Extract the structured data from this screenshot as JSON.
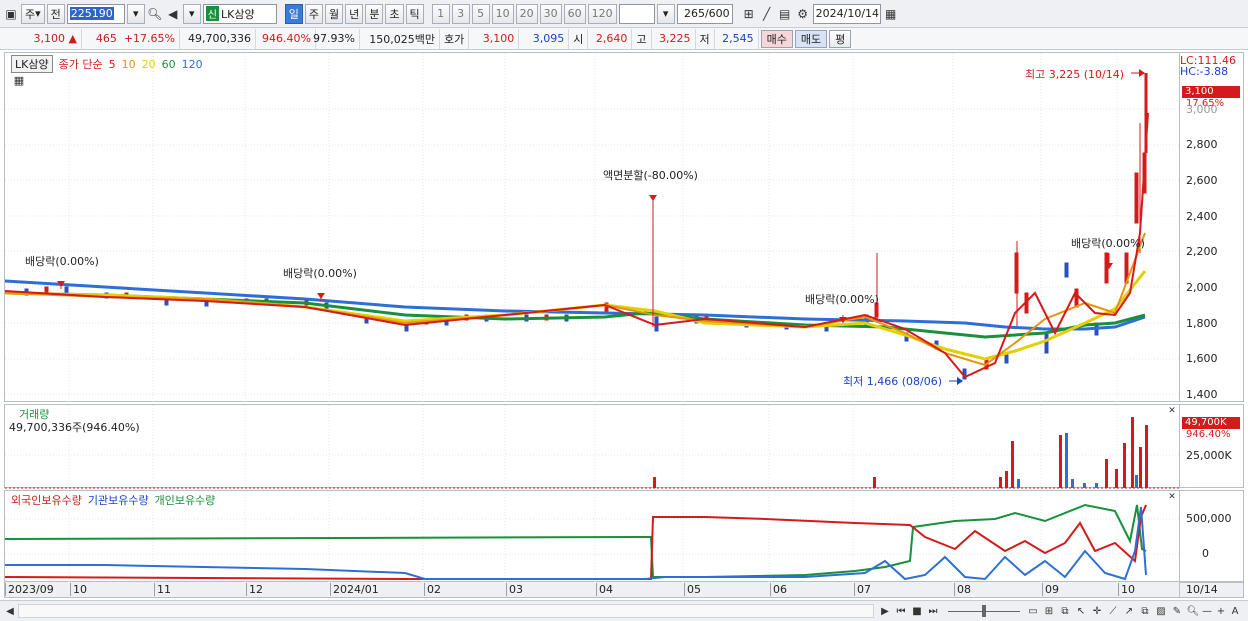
{
  "toolbar": {
    "mode_label": "주",
    "prev_label": "전",
    "code": "225190",
    "new_badge": "신",
    "stock_name": "LK삼양",
    "periods": [
      "일",
      "주",
      "월",
      "년",
      "분",
      "초",
      "틱"
    ],
    "active_period": "일",
    "intervals": [
      "1",
      "3",
      "5",
      "10",
      "20",
      "30",
      "60",
      "120"
    ],
    "count_value": "265",
    "count_total": "/600",
    "date": "2024/10/14"
  },
  "quote": {
    "price": "3,100",
    "arrow": "▲",
    "change": "465",
    "change_pct": "+17.65%",
    "volume": "49,700,336",
    "volume_ratio": "946.40%",
    "turnover": "97.93%",
    "amount": "150,025백만",
    "bid_label": "호가",
    "ask_price": "3,100",
    "bid_price": "3,095",
    "open_label": "시",
    "open": "2,640",
    "high_label": "고",
    "high": "3,225",
    "low_label": "저",
    "low": "2,545",
    "buy_label": "매수",
    "sell_label": "매도",
    "eval_label": "평"
  },
  "price_panel": {
    "legend_name": "LK삼양",
    "legend_ma_title": "종가 단순",
    "ma": [
      {
        "label": "5",
        "color": "#d41a1a"
      },
      {
        "label": "10",
        "color": "#e8930e"
      },
      {
        "label": "20",
        "color": "#e3d000"
      },
      {
        "label": "60",
        "color": "#1a8f3c"
      },
      {
        "label": "120",
        "color": "#2d6fd6"
      }
    ],
    "lc": "LC:111.46",
    "hc": "HC:-3.88",
    "last_price": "3,100",
    "last_pct": "17.65%",
    "y_ticks": [
      "3,000",
      "2,800",
      "2,600",
      "2,400",
      "2,200",
      "2,000",
      "1,800",
      "1,600",
      "1,400"
    ],
    "annotations": {
      "div1": "배당락(0.00%)",
      "div2": "배당락(0.00%)",
      "split": "액면분할(-80.00%)",
      "div3": "배당락(0.00%)",
      "div4": "배당락(0.00%)",
      "high": "최고 3,225 (10/14)",
      "low": "최저 1,466 (08/06)"
    }
  },
  "volume_panel": {
    "title": "거래량",
    "value": "49,700,336주(946.40%)",
    "last": "49,700K",
    "last_pct": "946.40%",
    "tick": "25,000K"
  },
  "holding_panel": {
    "legend": [
      {
        "label": "외국인보유수량",
        "color": "#d41a1a"
      },
      {
        "label": "기관보유수량",
        "color": "#2d6fd6"
      },
      {
        "label": "개인보유수량",
        "color": "#1a8f3c"
      }
    ],
    "ticks": [
      "500,000",
      "0"
    ]
  },
  "x_axis": {
    "labels": [
      "2023/09",
      "10",
      "11",
      "12",
      "2024/01",
      "02",
      "03",
      "04",
      "05",
      "06",
      "07",
      "08",
      "09",
      "10"
    ],
    "end_label": "10/14"
  }
}
